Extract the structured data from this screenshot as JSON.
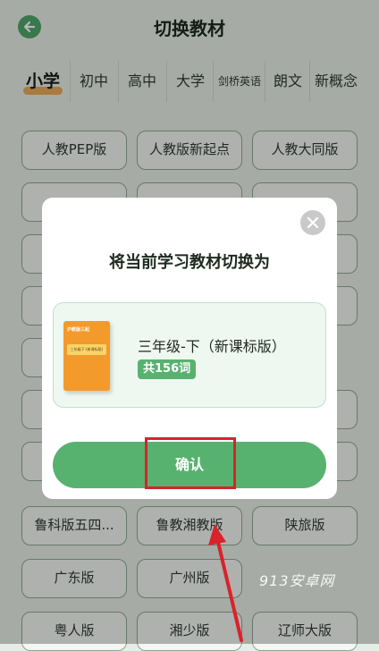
{
  "header": {
    "title": "切换教材"
  },
  "tabs": [
    {
      "label": "小学",
      "active": true
    },
    {
      "label": "初中"
    },
    {
      "label": "高中"
    },
    {
      "label": "大学"
    },
    {
      "label": "剑桥英语"
    },
    {
      "label": "朗文"
    },
    {
      "label": "新概念"
    }
  ],
  "editions": [
    "人教PEP版",
    "人教版新起点",
    "人教大同版",
    "鲁科版五四...",
    "鲁教湘教版",
    "陕旅版",
    "广东版",
    "广州版",
    "粤人版",
    "湘少版",
    "辽师大版"
  ],
  "modal": {
    "title": "将当前学习教材切换为",
    "book": {
      "name": "三年级-下（新课标版）",
      "word_count": "共156词",
      "cover_title": "沪教版三起",
      "cover_label": "三年级下·(新课标版)"
    },
    "confirm_label": "确认"
  },
  "watermark": "913安卓网",
  "colors": {
    "accent": "#58b26f",
    "highlight": "#d8232a"
  }
}
